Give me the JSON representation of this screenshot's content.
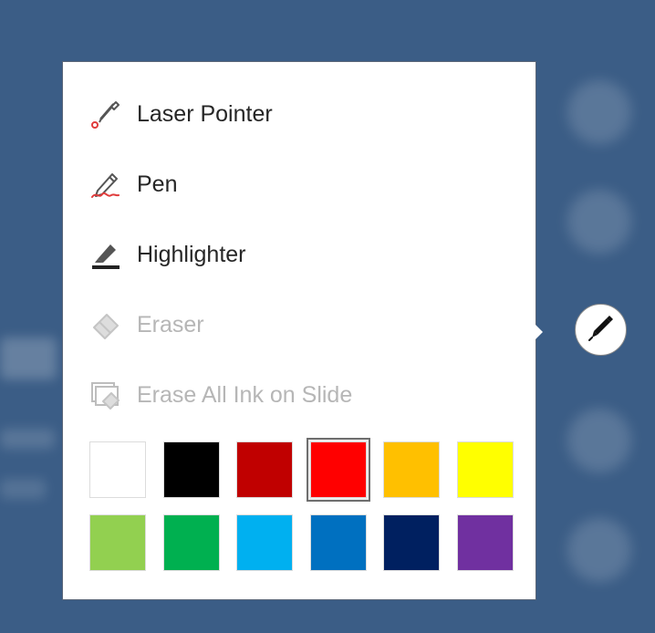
{
  "menu": {
    "items": [
      {
        "label": "Laser Pointer",
        "icon": "laser-pointer-icon",
        "enabled": true
      },
      {
        "label": "Pen",
        "icon": "pen-icon",
        "enabled": true
      },
      {
        "label": "Highlighter",
        "icon": "highlighter-icon",
        "enabled": true
      },
      {
        "label": "Eraser",
        "icon": "eraser-icon",
        "enabled": false
      },
      {
        "label": "Erase All Ink on Slide",
        "icon": "erase-all-ink-icon",
        "enabled": false
      }
    ],
    "colors": [
      {
        "name": "White",
        "hex": "#FFFFFF"
      },
      {
        "name": "Black",
        "hex": "#000000"
      },
      {
        "name": "Dark Red",
        "hex": "#C00000"
      },
      {
        "name": "Red",
        "hex": "#FF0000",
        "selected": true
      },
      {
        "name": "Orange",
        "hex": "#FFC000"
      },
      {
        "name": "Yellow",
        "hex": "#FFFF00"
      },
      {
        "name": "Light Green",
        "hex": "#92D050"
      },
      {
        "name": "Green",
        "hex": "#00B050"
      },
      {
        "name": "Light Blue",
        "hex": "#00B0F0"
      },
      {
        "name": "Blue",
        "hex": "#0070C0"
      },
      {
        "name": "Dark Blue",
        "hex": "#002060"
      },
      {
        "name": "Purple",
        "hex": "#7030A0"
      }
    ]
  },
  "pen_button": {
    "icon": "pen-icon"
  },
  "theme": {
    "background": "#3B5D86",
    "ink_accent": "#E03C3C"
  }
}
